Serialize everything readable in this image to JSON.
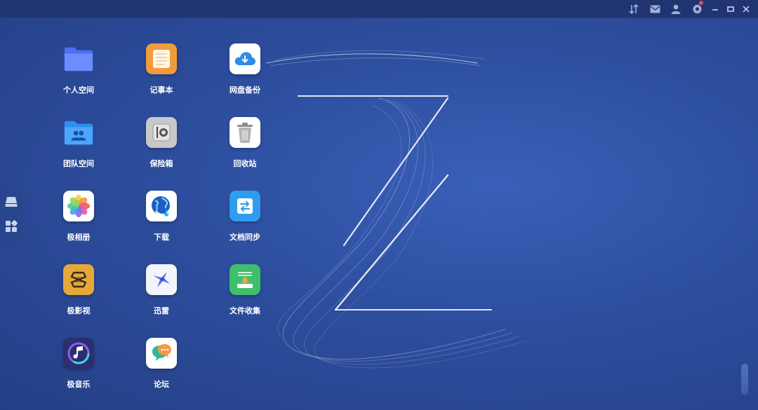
{
  "titlebar": {
    "icons": [
      "transfer-icon",
      "mail-icon",
      "user-icon",
      "gear-icon"
    ],
    "window_controls": [
      "minimize-icon",
      "maximize-icon",
      "close-icon"
    ],
    "notification_color": "#e84d4d"
  },
  "side_dock": {
    "icons": [
      "drive-icon",
      "apps-grid-icon"
    ]
  },
  "apps": [
    {
      "id": "personal-space",
      "label": "个人空间",
      "icon": "folder-icon"
    },
    {
      "id": "notepad",
      "label": "记事本",
      "icon": "notepad-icon"
    },
    {
      "id": "cloud-backup",
      "label": "网盘备份",
      "icon": "cloud-download-icon"
    },
    {
      "id": "team-space",
      "label": "团队空间",
      "icon": "team-folder-icon"
    },
    {
      "id": "safe",
      "label": "保险箱",
      "icon": "safe-icon"
    },
    {
      "id": "recycle-bin",
      "label": "回收站",
      "icon": "trash-icon"
    },
    {
      "id": "photos",
      "label": "极相册",
      "icon": "photos-icon"
    },
    {
      "id": "download",
      "label": "下载",
      "icon": "globe-download-icon"
    },
    {
      "id": "doc-sync",
      "label": "文档同步",
      "icon": "sync-icon"
    },
    {
      "id": "video",
      "label": "极影视",
      "icon": "video-icon"
    },
    {
      "id": "thunder",
      "label": "迅雷",
      "icon": "thunder-bird-icon"
    },
    {
      "id": "file-collect",
      "label": "文件收集",
      "icon": "file-collect-icon"
    },
    {
      "id": "music",
      "label": "极音乐",
      "icon": "music-icon"
    },
    {
      "id": "forum",
      "label": "论坛",
      "icon": "forum-chat-icon"
    }
  ],
  "colors": {
    "background": "#2d4e9e",
    "titlebar": "#1f3470",
    "label": "#ffffff"
  }
}
